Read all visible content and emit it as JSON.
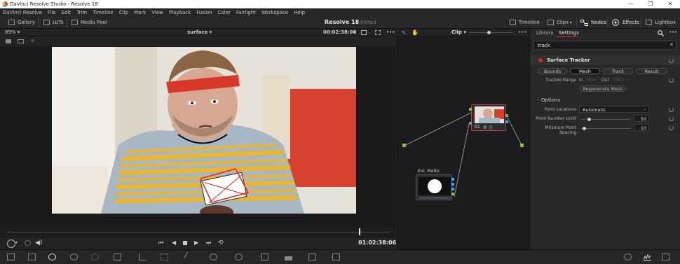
{
  "window": {
    "title": "DaVinci Resolve Studio - Resolve 18",
    "controls": [
      "—",
      "❐",
      "✕"
    ]
  },
  "menu": [
    "DaVinci Resolve",
    "File",
    "Edit",
    "Trim",
    "Timeline",
    "Clip",
    "Mark",
    "View",
    "Playback",
    "Fusion",
    "Color",
    "Fairlight",
    "Workspace",
    "Help"
  ],
  "toolbar": {
    "gallery": "Gallery",
    "luts": "LUTs",
    "media_pool": "Media Pool",
    "project_title": "Resolve 18",
    "project_status": "Edited",
    "timeline": "Timeline",
    "clips": "Clips",
    "nodes": "Nodes",
    "effects": "Effects",
    "lightbox": "Lightbox"
  },
  "viewer": {
    "zoom": "89%",
    "clip_name": "surface",
    "timecode_top": "00:02:38:06",
    "timecode_bottom": "01:02:38:06",
    "playhead_fraction": 0.92
  },
  "node_editor": {
    "mode": "Clip",
    "node1_label": "01",
    "matte_label": "Ext. Matte"
  },
  "inspector": {
    "tab_library": "Library",
    "tab_settings": "Settings",
    "search_value": "track",
    "tool_name": "Surface Tracker",
    "tabs": [
      "Bounds",
      "Mesh",
      "Track",
      "Result"
    ],
    "active_tab": "Mesh",
    "tracked_range_label": "Tracked Range",
    "in_label": "In",
    "in_value": "3841",
    "out_label": "Out",
    "out_value": "3963",
    "regen_button": "Regenerate Mesh",
    "options_header": "Options",
    "point_locations_label": "Point Locations",
    "point_locations_value": "Automatic",
    "point_number_limit_label": "Point Number Limit",
    "point_number_limit_value": "50",
    "min_spacing_label": "Minimum Point Spacing",
    "min_spacing_value": "10"
  },
  "colors": {
    "accent_red": "#e2231a",
    "node_selected": "#c93a35",
    "green_port": "#7fc241",
    "blue_port": "#3fa9f5"
  }
}
